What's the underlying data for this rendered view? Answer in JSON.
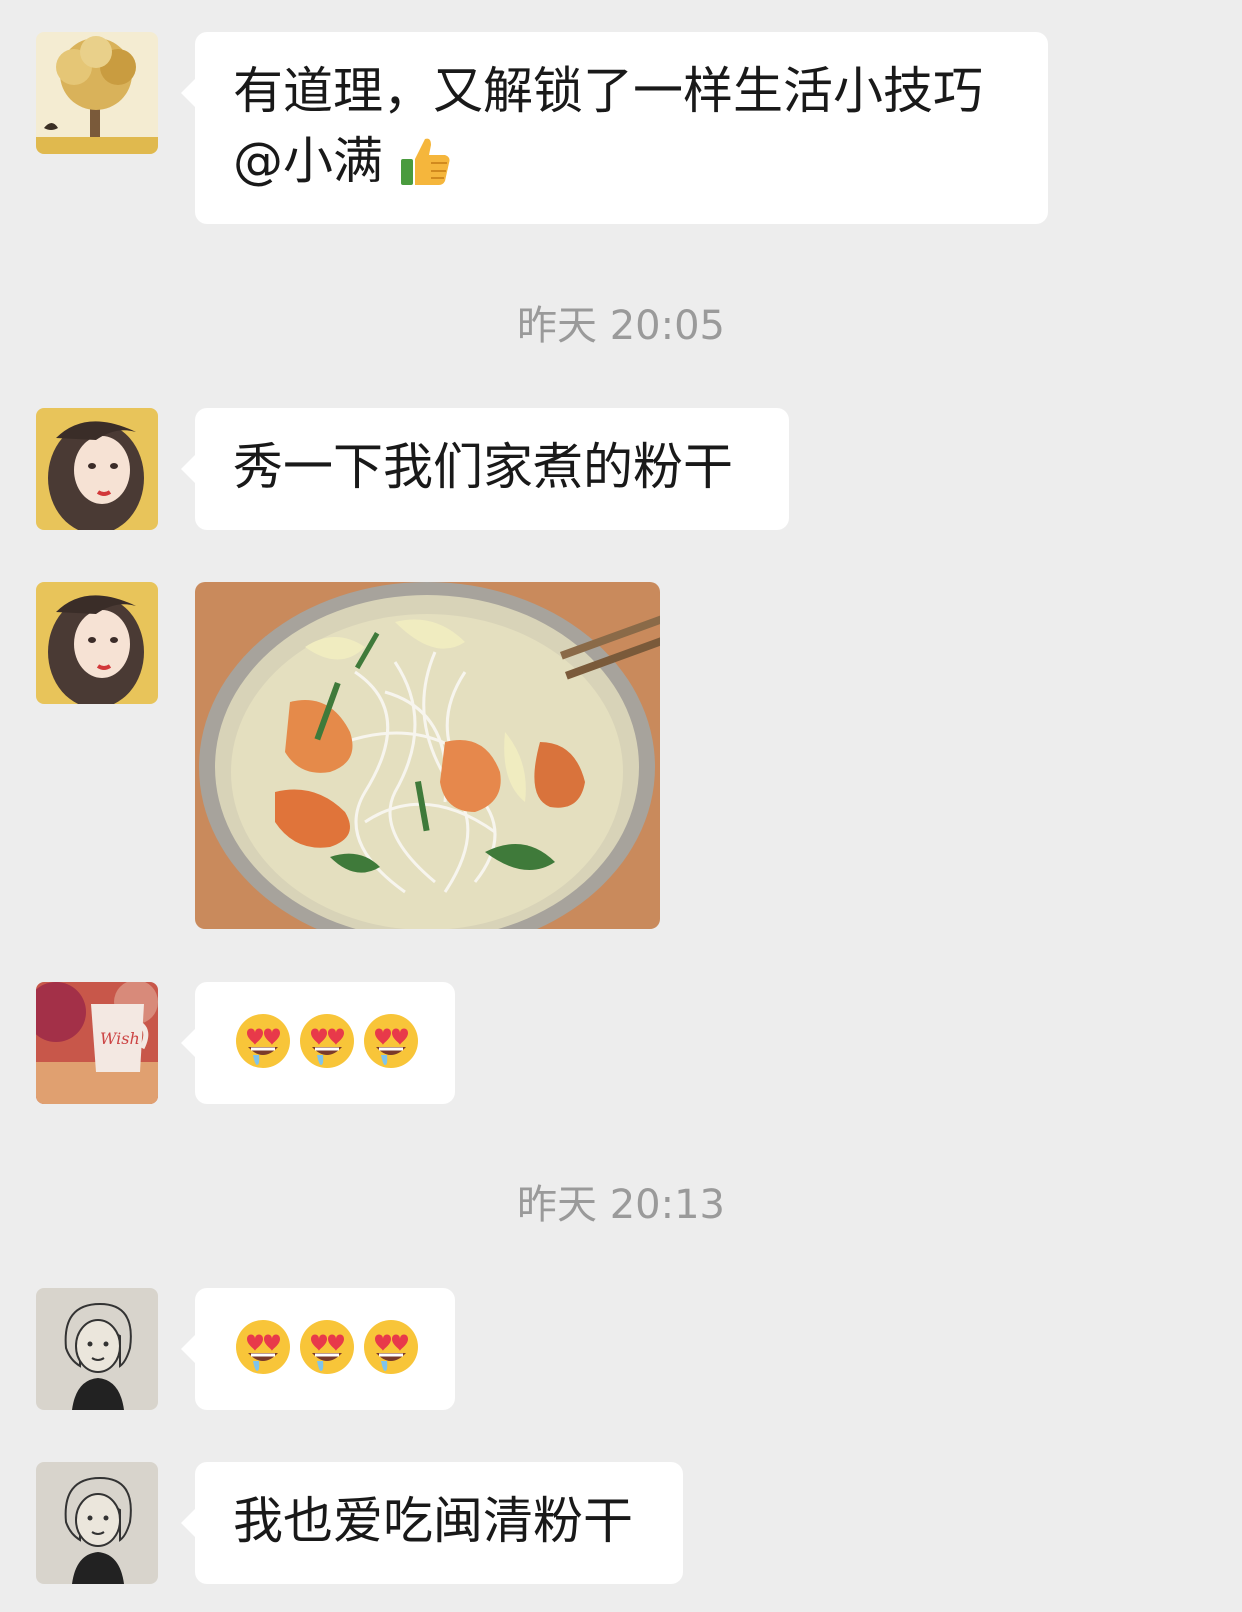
{
  "messages": [
    {
      "text_line1": "有道理，又解锁了一样生活小技巧",
      "text_line2": "@小满",
      "emoji": "thumbs-up"
    },
    {
      "text": "秀一下我们家煮的粉干"
    },
    {
      "image": "noodle-soup-with-shrimp"
    },
    {
      "emojis": [
        "heart-eyes-drool",
        "heart-eyes-drool",
        "heart-eyes-drool"
      ]
    },
    {
      "emojis": [
        "heart-eyes-drool",
        "heart-eyes-drool",
        "heart-eyes-drool"
      ]
    },
    {
      "text": "我也爱吃闽清粉干"
    }
  ],
  "timestamps": {
    "first": "昨天 20:05",
    "second": "昨天 20:13"
  }
}
